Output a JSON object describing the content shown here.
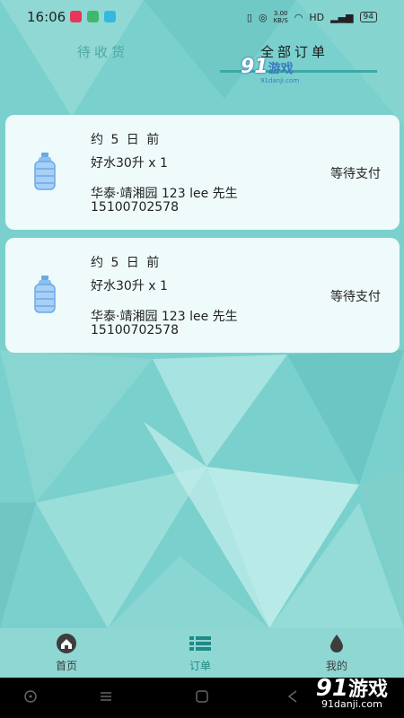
{
  "status_bar": {
    "time": "16:06",
    "network_speed_value": "3.00",
    "network_speed_unit": "KB/S",
    "network_type": "HD",
    "battery": "94"
  },
  "tabs": [
    {
      "label": "待收货",
      "active": false
    },
    {
      "label": "全部订单",
      "active": true
    }
  ],
  "watermark": {
    "logo_number": "91",
    "logo_text": "游戏",
    "url": "91danji.com"
  },
  "orders": [
    {
      "time": "约 5 日 前",
      "product": "好水30升 x 1",
      "address": "华泰·靖湘园  123 lee 先生",
      "phone": "15100702578",
      "status": "等待支付",
      "icon": "water-bottle-icon"
    },
    {
      "time": "约 5 日 前",
      "product": "好水30升 x 1",
      "address": "华泰·靖湘园  123 lee 先生",
      "phone": "15100702578",
      "status": "等待支付",
      "icon": "water-bottle-icon"
    }
  ],
  "bottom_nav": [
    {
      "label": "首页",
      "icon": "home-icon",
      "active": false
    },
    {
      "label": "订单",
      "icon": "list-icon",
      "active": true
    },
    {
      "label": "我的",
      "icon": "drop-icon",
      "active": false
    }
  ],
  "colors": {
    "accent": "#3aa9a4",
    "background": "#78cfcc",
    "card": "#f5fcfc"
  }
}
